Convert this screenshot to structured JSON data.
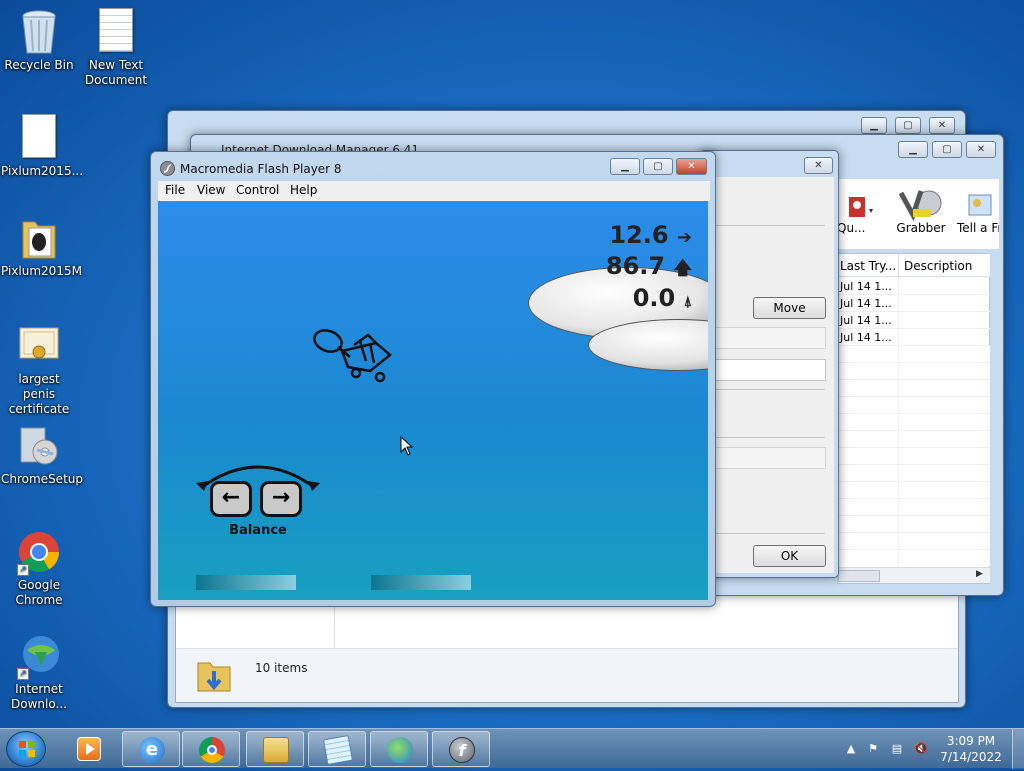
{
  "desktop": {
    "icons": [
      {
        "label": "Recycle Bin",
        "icon": "recycle-bin-icon"
      },
      {
        "label": "New Text Document",
        "icon": "text-document-icon"
      },
      {
        "label": "Pixlum2015...",
        "icon": "document-icon"
      },
      {
        "label": "Pixlum2015M",
        "icon": "folder-icon"
      },
      {
        "label": "largest penis certificate",
        "icon": "certificate-icon"
      },
      {
        "label": "ChromeSetup",
        "icon": "installer-icon"
      },
      {
        "label": "Google Chrome",
        "icon": "chrome-icon"
      },
      {
        "label": "Internet Downlo...",
        "icon": "idm-icon"
      }
    ]
  },
  "idm_window": {
    "title": "Internet Download Manager 6.41",
    "toolbar": [
      {
        "label": "Qu...",
        "icon": "scheduler-icon"
      },
      {
        "label": "Grabber",
        "icon": "grabber-icon"
      },
      {
        "label": "Tell a Fri",
        "icon": "tell-friend-icon"
      }
    ],
    "columns": [
      "Last Try...",
      "Description"
    ],
    "rows": [
      "Jul 14 1...",
      "Jul 14 1...",
      "Jul 14 1...",
      "Jul 14 1..."
    ]
  },
  "dialog": {
    "move_label": "Move",
    "ok_label": "OK"
  },
  "explorer": {
    "status": "10 items"
  },
  "flash_window": {
    "title": "Macromedia Flash Player 8",
    "menu": [
      "File",
      "View",
      "Control",
      "Help"
    ],
    "stats": [
      {
        "value": "12.6",
        "icon": "arrow-right-icon"
      },
      {
        "value": "86.7",
        "icon": "arrow-up-icon"
      },
      {
        "value": "0.0",
        "icon": "tilt-icon"
      }
    ],
    "balance_label": "Balance"
  },
  "taskbar": {
    "clock_time": "3:09 PM",
    "clock_date": "7/14/2022",
    "apps": [
      {
        "name": "media-player-icon"
      },
      {
        "name": "internet-explorer-icon"
      },
      {
        "name": "chrome-icon"
      },
      {
        "name": "explorer-icon"
      },
      {
        "name": "notepad-icon"
      },
      {
        "name": "idm-icon"
      },
      {
        "name": "flash-icon"
      }
    ]
  },
  "colors": {
    "desktop": "#1a6fc4",
    "flash_sky": "#2d8cea",
    "title_close": "#c24128"
  }
}
